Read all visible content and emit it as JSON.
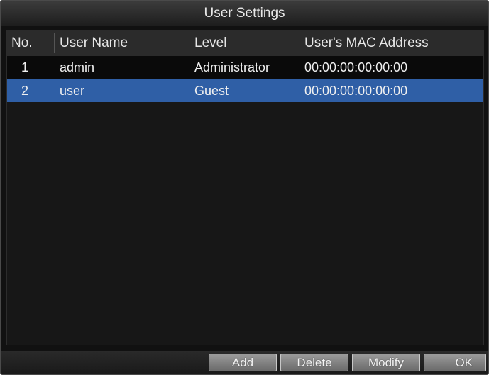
{
  "window": {
    "title": "User Settings"
  },
  "table": {
    "headers": {
      "no": "No.",
      "user_name": "User Name",
      "level": "Level",
      "mac": "User's MAC Address"
    },
    "rows": [
      {
        "no": "1",
        "user_name": "admin",
        "level": "Administrator",
        "mac": "00:00:00:00:00:00",
        "selected": false
      },
      {
        "no": "2",
        "user_name": "user",
        "level": "Guest",
        "mac": "00:00:00:00:00:00",
        "selected": true
      }
    ]
  },
  "buttons": {
    "add": "Add",
    "delete": "Delete",
    "modify": "Modify",
    "ok": "OK"
  },
  "colors": {
    "selection": "#2f5fa6",
    "background": "#111111"
  }
}
